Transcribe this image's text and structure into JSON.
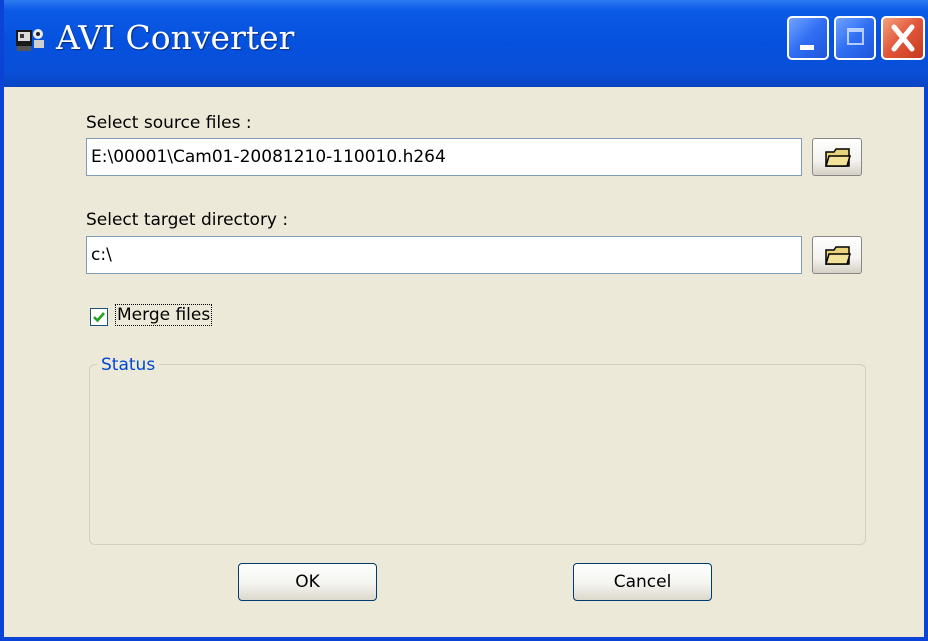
{
  "window": {
    "title": "AVI Converter",
    "app_icon": "avi-converter-icon",
    "controls": [
      "minimize-icon",
      "maximize-icon",
      "close-icon"
    ]
  },
  "source": {
    "label": "Select source files :",
    "value": "E:\\00001\\Cam01-20081210-110010.h264",
    "browse_icon": "folder-icon"
  },
  "target": {
    "label": "Select target directory :",
    "value": "c:\\",
    "browse_icon": "folder-icon"
  },
  "merge": {
    "label": "Merge files",
    "checked": true
  },
  "status": {
    "title": "Status"
  },
  "buttons": {
    "ok": "OK",
    "cancel": "Cancel"
  },
  "colors": {
    "titlebar": "#0551DE",
    "window_bg": "#ECE9D8",
    "close_button": "#E2553A",
    "group_title": "#0046D5"
  }
}
